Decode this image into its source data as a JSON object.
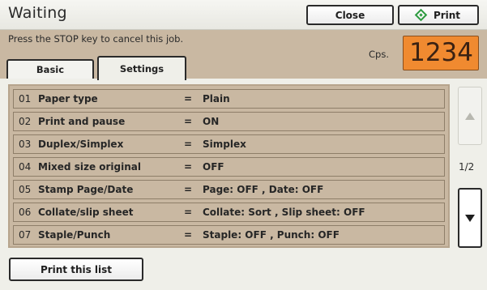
{
  "window": {
    "title": "Waiting"
  },
  "header": {
    "close_label": "Close",
    "print_label": "Print",
    "stop_message": "Press the STOP key to cancel this job.",
    "cps_label": "Cps.",
    "counter_value": "1234",
    "counter_color": "#f08a30"
  },
  "tabs": [
    {
      "label": "Basic",
      "active": false
    },
    {
      "label": "Settings",
      "active": true
    }
  ],
  "settings_list": {
    "items": [
      {
        "num": "01",
        "name": "Paper type",
        "eq": "=",
        "value": "Plain"
      },
      {
        "num": "02",
        "name": "Print and pause",
        "eq": "=",
        "value": "ON"
      },
      {
        "num": "03",
        "name": "Duplex/Simplex",
        "eq": "=",
        "value": "Simplex"
      },
      {
        "num": "04",
        "name": "Mixed size original",
        "eq": "=",
        "value": "OFF"
      },
      {
        "num": "05",
        "name": "Stamp Page/Date",
        "eq": "=",
        "value": "Page: OFF , Date: OFF"
      },
      {
        "num": "06",
        "name": "Collate/slip sheet",
        "eq": "=",
        "value": "Collate: Sort , Slip sheet: OFF"
      },
      {
        "num": "07",
        "name": "Staple/Punch",
        "eq": "=",
        "value": "Staple: OFF , Punch: OFF"
      }
    ]
  },
  "pagination": {
    "indicator": "1/2"
  },
  "footer": {
    "print_list_label": "Print this list"
  },
  "icons": {
    "print": "diamond-print-icon",
    "scroll_up": "triangle-up-icon",
    "scroll_down": "triangle-down-icon"
  }
}
